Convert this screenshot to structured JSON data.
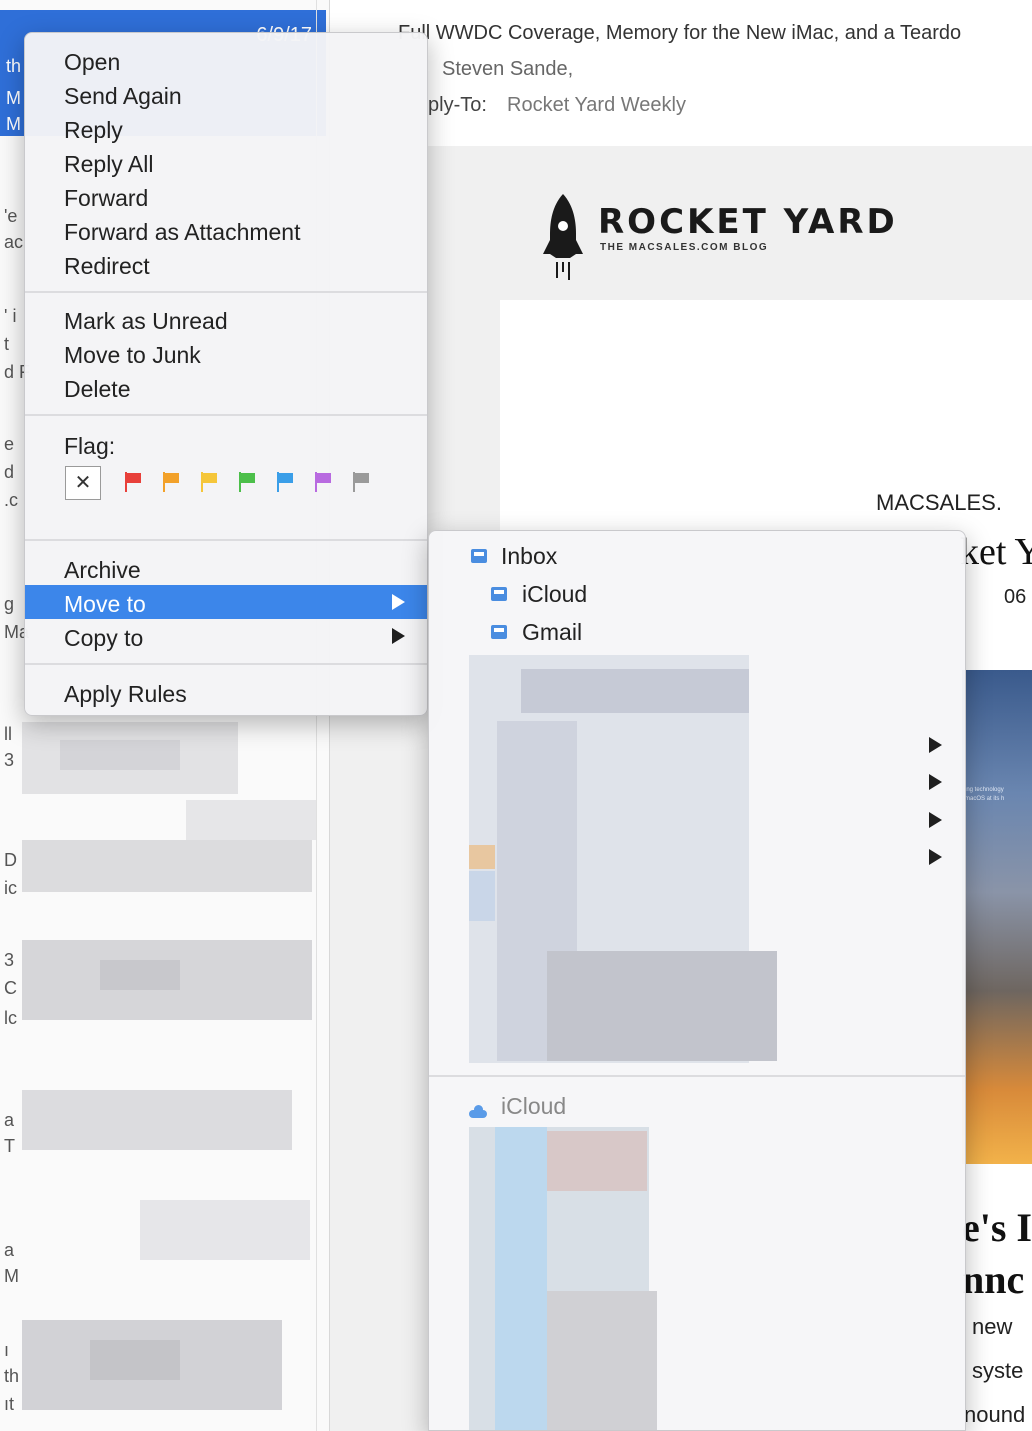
{
  "message_list": {
    "selected_date": "6/9/17",
    "selected_fragments": [
      "th",
      "M",
      "M"
    ],
    "left_fragments": [
      "'e",
      "ac",
      "' i",
      "t",
      "d F",
      "e",
      "d",
      ".c",
      "g",
      "Ma",
      "ll",
      "3",
      "D",
      "ic",
      "3",
      "C",
      "lc",
      "a",
      "M",
      "a",
      "T",
      "ı",
      "th",
      "ıt"
    ]
  },
  "message_header": {
    "subject": "Full WWDC Coverage, Memory for the New iMac, and a Teardo",
    "from": "Steven Sande,",
    "reply_to_label": "ply-To:",
    "reply_to_value": "Rocket Yard Weekly"
  },
  "newsletter": {
    "logo_title": "ROCKET YARD",
    "logo_subtitle": "THE MACSALES.COM BLOG",
    "macsales_fragment": "MACSALES.",
    "title_fragment": "ket Y",
    "date_fragment": "06",
    "image_text": [
      "ing technology",
      "macOS at its h"
    ],
    "headline_line1": "e's I",
    "headline_line2": "nnc",
    "body_line1": "new",
    "body_line2": "syste",
    "body_line3": "nound"
  },
  "context_menu": {
    "group1": [
      "Open",
      "Send Again",
      "Reply",
      "Reply All",
      "Forward",
      "Forward as Attachment",
      "Redirect"
    ],
    "group2": [
      "Mark as Unread",
      "Move to Junk",
      "Delete"
    ],
    "flag_label": "Flag:",
    "clear_flag": "✕",
    "flag_colors": [
      "#e8403a",
      "#f2a12a",
      "#f5c63a",
      "#4cbf4a",
      "#3a9ee8",
      "#b86ae0",
      "#9a9a9a"
    ],
    "archive": "Archive",
    "move_to": "Move to",
    "copy_to": "Copy to",
    "apply_rules": "Apply Rules",
    "active_color": "#3c86ea"
  },
  "submenu": {
    "inbox": "Inbox",
    "icloud": "iCloud",
    "gmail": "Gmail",
    "icloud_section": "iCloud",
    "icons": {
      "inbox": "inbox-tray-icon",
      "icloud": "inbox-tray-icon",
      "gmail": "inbox-tray-icon",
      "icloud_section": "cloud-icon"
    }
  }
}
